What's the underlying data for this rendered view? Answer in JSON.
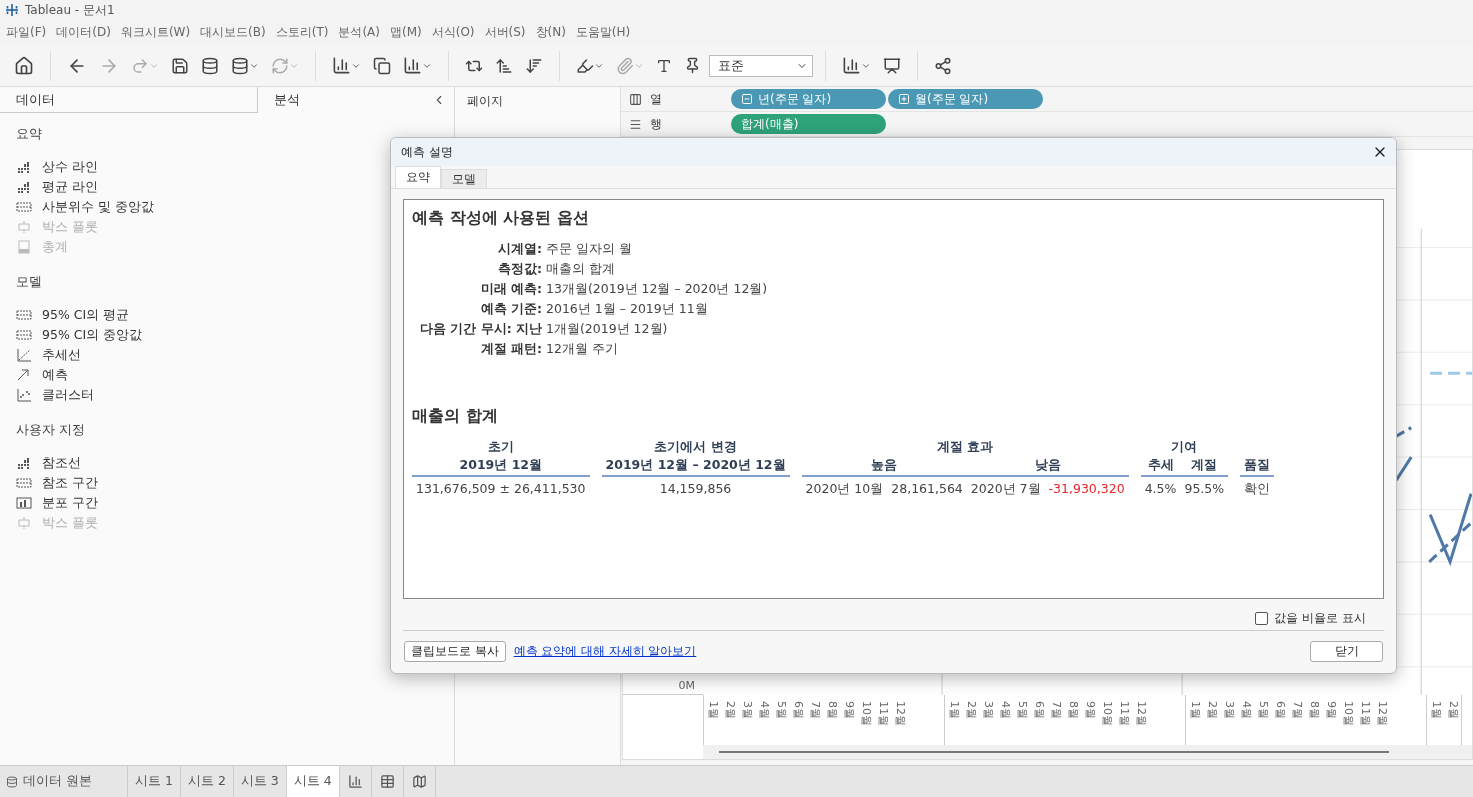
{
  "window": {
    "title": "Tableau - 문서1"
  },
  "menu": [
    "파일(F)",
    "데이터(D)",
    "워크시트(W)",
    "대시보드(B)",
    "스토리(T)",
    "분석(A)",
    "맵(M)",
    "서식(O)",
    "서버(S)",
    "창(N)",
    "도움말(H)"
  ],
  "toolbar": {
    "fit_select": {
      "value": "표준"
    }
  },
  "side_panel": {
    "tabs": [
      {
        "label": "데이터",
        "selected": false
      },
      {
        "label": "분석",
        "selected": true
      }
    ],
    "sections": [
      {
        "title": "요약",
        "items": [
          {
            "kind": "line",
            "label": "상수 라인",
            "disabled": false
          },
          {
            "kind": "line",
            "label": "평균 라인",
            "disabled": false
          },
          {
            "kind": "band",
            "label": "사분위수 및 중앙값",
            "disabled": false
          },
          {
            "kind": "boxplot",
            "label": "박스 플롯",
            "disabled": true
          },
          {
            "kind": "total",
            "label": "총계",
            "disabled": true
          }
        ]
      },
      {
        "title": "모델",
        "items": [
          {
            "kind": "band",
            "label": "95% CI의 평균",
            "disabled": false
          },
          {
            "kind": "band",
            "label": "95% CI의 중앙값",
            "disabled": false
          },
          {
            "kind": "trend",
            "label": "추세선",
            "disabled": false
          },
          {
            "kind": "forecast",
            "label": "예측",
            "disabled": false
          },
          {
            "kind": "cluster",
            "label": "클러스터",
            "disabled": false
          }
        ]
      },
      {
        "title": "사용자 지정",
        "items": [
          {
            "kind": "line",
            "label": "참조선",
            "disabled": false
          },
          {
            "kind": "band",
            "label": "참조 구간",
            "disabled": false
          },
          {
            "kind": "distribution",
            "label": "분포 구간",
            "disabled": false
          },
          {
            "kind": "boxplot",
            "label": "박스 플롯",
            "disabled": true
          }
        ]
      }
    ]
  },
  "pages_shelf": {
    "title": "페이지"
  },
  "columns_shelf": {
    "label": "열",
    "pills": [
      {
        "kind": "collapse",
        "label": "년(주문 일자)"
      },
      {
        "kind": "expand",
        "label": "월(주문 일자)"
      }
    ]
  },
  "rows_shelf": {
    "label": "행",
    "pills": [
      {
        "kind": "measure",
        "label": "합계(매출)"
      }
    ]
  },
  "view": {
    "axis_label": "0M",
    "month_groups": [
      [
        "1월",
        "2월",
        "3월",
        "4월",
        "5월",
        "6월",
        "7월",
        "8월",
        "9월",
        "10월",
        "11월",
        "12월"
      ],
      [
        "1월",
        "2월",
        "3월",
        "4월",
        "5월",
        "6월",
        "7월",
        "8월",
        "9월",
        "10월",
        "11월",
        "12월"
      ],
      [
        "1월",
        "2월",
        "3월",
        "4월",
        "5월",
        "6월",
        "7월",
        "8월",
        "9월",
        "10월",
        "11월",
        "12월"
      ],
      [
        "1월",
        "2월"
      ]
    ]
  },
  "dialog": {
    "title": "예측 설명",
    "tabs": [
      {
        "label": "요약",
        "selected": true
      },
      {
        "label": "모델",
        "selected": false
      }
    ],
    "options_heading": "예측 작성에 사용된 옵션",
    "options": [
      {
        "label": "시계열:",
        "value": "주문 일자의 월"
      },
      {
        "label": "측정값:",
        "value": "매출의 합계"
      },
      {
        "label": "미래 예측:",
        "value": "13개월(2019년 12월 – 2020년 12월)"
      },
      {
        "label": "예측 기준:",
        "value": "2016년 1월 – 2019년 11월"
      },
      {
        "label": "다음 기간 무시: 지난",
        "value": "1개월(2019년 12월)"
      },
      {
        "label": "계절 패턴:",
        "value": "12개월 주기"
      }
    ],
    "summary_heading": "매출의 합계",
    "summary_groups": [
      {
        "title": "초기",
        "columns": [
          {
            "heading": "2019년 12월",
            "values": [
              {
                "text": "131,676,509 ±  26,411,530",
                "negative": false
              }
            ]
          }
        ]
      },
      {
        "title": "초기에서 변경",
        "columns": [
          {
            "heading": "2019년 12월 – 2020년 12월",
            "values": [
              {
                "text": "14,159,856",
                "negative": false
              }
            ]
          }
        ]
      },
      {
        "title": "계절 효과",
        "columns": [
          {
            "heading": "높음",
            "values": [
              {
                "text": "2020년 10월",
                "negative": false
              },
              {
                "text": "28,161,564",
                "negative": false
              }
            ]
          },
          {
            "heading": "낮음",
            "values": [
              {
                "text": "2020년 7월",
                "negative": false
              },
              {
                "text": "-31,930,320",
                "negative": true
              }
            ]
          }
        ]
      },
      {
        "title": "기여",
        "columns": [
          {
            "heading": "추세",
            "values": [
              {
                "text": "4.5%",
                "negative": false
              }
            ]
          },
          {
            "heading": "계절",
            "values": [
              {
                "text": "95.5%",
                "negative": false
              }
            ]
          }
        ]
      },
      {
        "columns": [
          {
            "heading": "품질",
            "values": [
              {
                "text": "확인",
                "negative": false
              }
            ]
          }
        ]
      }
    ],
    "ratio_checkbox": {
      "label": "값을 비율로 표시",
      "checked": false
    },
    "copy_button": "클립보드로 복사",
    "learn_link": "예측 요약에 대해 자세히 알아보기",
    "close_button": "닫기"
  },
  "sheet_tabs": {
    "data_source": "데이터 원본",
    "sheets": [
      {
        "label": "시트 1",
        "selected": false
      },
      {
        "label": "시트 2",
        "selected": false
      },
      {
        "label": "시트 3",
        "selected": false
      },
      {
        "label": "시트 4",
        "selected": true
      }
    ]
  }
}
